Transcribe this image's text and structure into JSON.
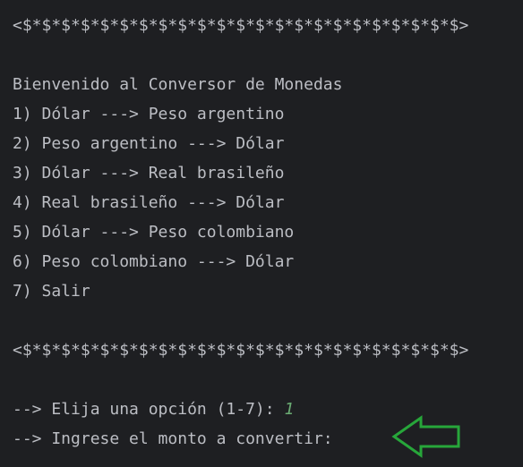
{
  "console": {
    "separator_top": "<$*$*$*$*$*$*$*$*$*$*$*$*$*$*$*$*$*$*$*$*$*$*$>",
    "welcome": "Bienvenido al Conversor de Monedas",
    "menu_options": [
      "1) Dólar ---> Peso argentino",
      "2) Peso argentino ---> Dólar",
      "3) Dólar ---> Real brasileño",
      "4) Real brasileño ---> Dólar",
      "5) Dólar ---> Peso colombiano",
      "6) Peso colombiano ---> Dólar",
      "7) Salir"
    ],
    "separator_bottom": "<$*$*$*$*$*$*$*$*$*$*$*$*$*$*$*$*$*$*$*$*$*$*$>",
    "prompt_option": "--> Elija una opción (1-7): ",
    "prompt_option_input": "1",
    "prompt_amount": "--> Ingrese el monto a convertir: "
  },
  "annotation": {
    "icon": "arrow-left-icon",
    "color": "#27a63a"
  },
  "colors": {
    "background": "#1e1f22",
    "text": "#bcbec4",
    "user_input": "#6aab73"
  }
}
